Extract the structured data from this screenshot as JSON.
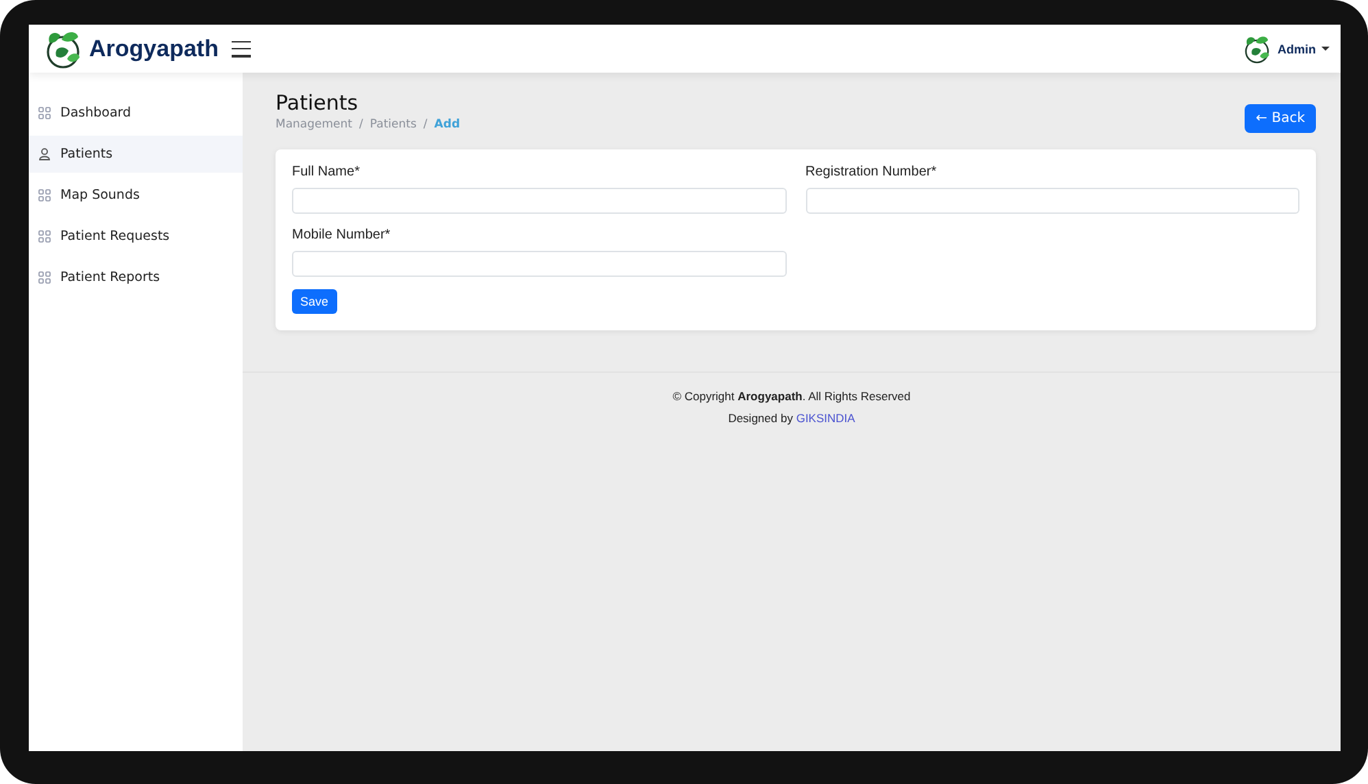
{
  "header": {
    "brand": "Arogyapath",
    "user": "Admin"
  },
  "sidebar": {
    "items": [
      {
        "label": "Dashboard",
        "kind": "module",
        "selected": false
      },
      {
        "label": "Patients",
        "kind": "people",
        "selected": true
      },
      {
        "label": "Map Sounds",
        "kind": "module",
        "selected": false
      },
      {
        "label": "Patient Requests",
        "kind": "module",
        "selected": false
      },
      {
        "label": "Patient Reports",
        "kind": "module",
        "selected": false
      }
    ]
  },
  "page": {
    "title": "Patients",
    "breadcrumb_separator": "/",
    "breadcrumb": [
      {
        "label": "Management",
        "current": false
      },
      {
        "label": "Patients",
        "current": false
      },
      {
        "label": "Add",
        "current": true
      }
    ],
    "back_button": "← Back"
  },
  "form": {
    "fields": [
      {
        "label": "Full Name*"
      },
      {
        "label": "Registration Number*"
      },
      {
        "label": "Mobile Number*"
      }
    ],
    "save_button": "Save"
  },
  "footer": {
    "copyright": "© Copyright **Arogyapath**. All Rights Reserved",
    "designed_by": "Designed by",
    "designer": "GIKSINDIA"
  }
}
